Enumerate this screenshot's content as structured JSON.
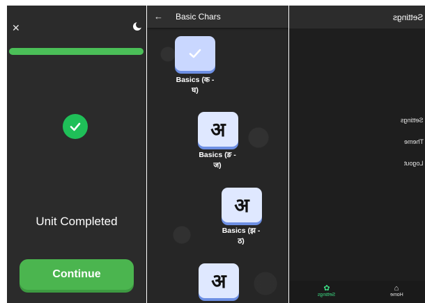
{
  "unit_completed_screen": {
    "progress": 1.0,
    "message": "Unit Completed",
    "continue_label": "Continue",
    "colors": {
      "accent_green": "#4bb54f",
      "check_green": "#1fbf58",
      "background": "#2b2b2b"
    }
  },
  "lessons_screen": {
    "title": "Basic Chars",
    "lessons": [
      {
        "glyph": "",
        "line1": "Basics (क -",
        "line2": "घ)",
        "completed": true
      },
      {
        "glyph": "अ",
        "line1": "Basics (ङ -",
        "line2": "ज)",
        "completed": false
      },
      {
        "glyph": "अ",
        "line1": "Basics (झ -",
        "line2": "ठ)",
        "completed": false
      },
      {
        "glyph": "अ",
        "line1": "",
        "line2": "",
        "completed": false
      }
    ],
    "colors": {
      "tile": "#dfe8ff",
      "tile_shadow": "#6d8fe3"
    }
  },
  "settings_screen": {
    "title": "Settings",
    "menu": [
      "Settings",
      "Theme",
      "Logout"
    ],
    "nav": {
      "settings_label": "Settings",
      "home_label": "Home"
    },
    "colors": {
      "active_nav": "#3ddc84"
    }
  }
}
